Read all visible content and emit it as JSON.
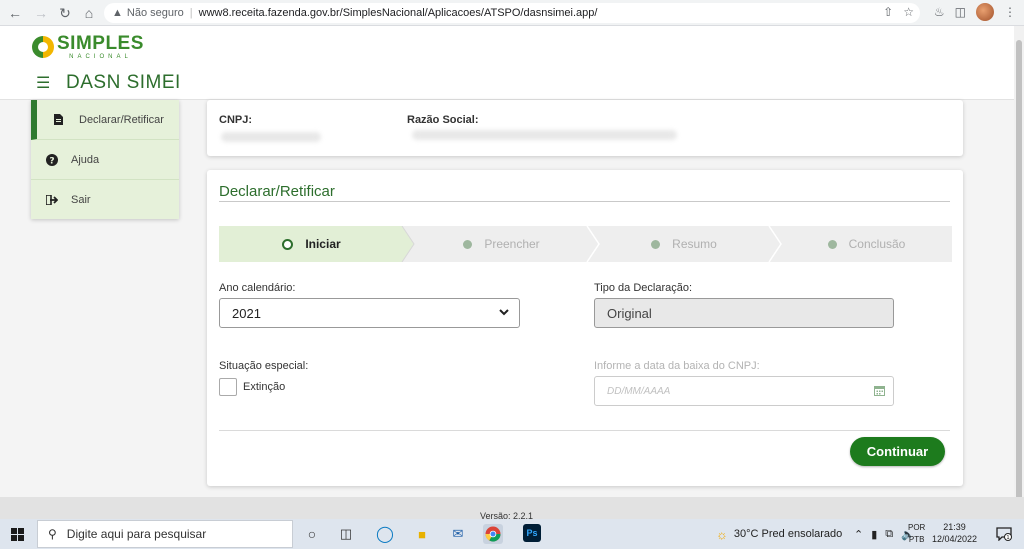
{
  "browser": {
    "security_label": "Não seguro",
    "url": "www8.receita.fazenda.gov.br/SimplesNacional/Aplicacoes/ATSPO/dasnsimei.app/"
  },
  "header": {
    "logo_title": "SIMPLES",
    "logo_sub": "NACIONAL",
    "app_name": "DASN SIMEI"
  },
  "sidebar": {
    "items": [
      {
        "label": "Declarar/Retificar",
        "icon": "document-icon",
        "active": true
      },
      {
        "label": "Ajuda",
        "icon": "question-icon",
        "active": false
      },
      {
        "label": "Sair",
        "icon": "sign-out-icon",
        "active": false
      }
    ]
  },
  "taxpayer": {
    "cnpj_label": "CNPJ:",
    "razao_label": "Razão Social:"
  },
  "form": {
    "title": "Declarar/Retificar",
    "steps": [
      {
        "label": "Iniciar",
        "state": "active"
      },
      {
        "label": "Preencher",
        "state": "inactive"
      },
      {
        "label": "Resumo",
        "state": "inactive"
      },
      {
        "label": "Conclusão",
        "state": "inactive"
      }
    ],
    "ano_label": "Ano calendário:",
    "ano_value": "2021",
    "tipo_label": "Tipo da Declaração:",
    "tipo_value": "Original",
    "situacao_label": "Situação especial:",
    "extincao_label": "Extinção",
    "extincao_checked": false,
    "data_baixa_label": "Informe a data da baixa do CNPJ:",
    "data_baixa_placeholder": "DD/MM/AAAA",
    "continue_label": "Continuar"
  },
  "footer": {
    "version": "Versão: 2.2.1"
  },
  "taskbar": {
    "search_placeholder": "Digite aqui para pesquisar",
    "weather": "30°C  Pred ensolarado",
    "lang_1": "POR",
    "lang_2": "PTB",
    "time": "21:39",
    "date": "12/04/2022",
    "notification_count": "1"
  },
  "colors": {
    "brand_green": "#2d6e2d",
    "button_green": "#1d7b1d",
    "sidebar_bg": "#e6f1da"
  }
}
